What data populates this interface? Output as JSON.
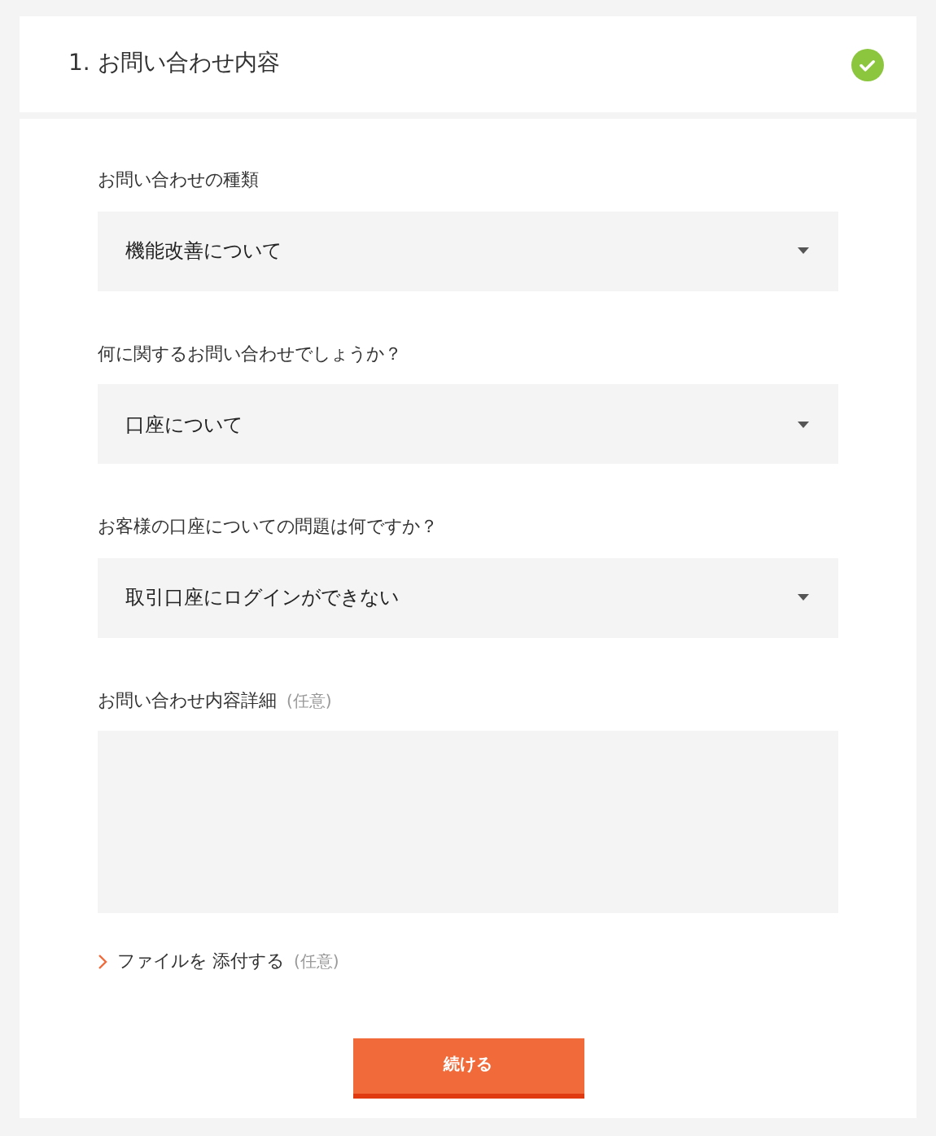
{
  "header": {
    "title": "1. お問い合わせ内容",
    "completed": true
  },
  "fields": [
    {
      "kind": "select",
      "label": "お問い合わせの種類",
      "value": "機能改善について"
    },
    {
      "kind": "select",
      "label": "何に関するお問い合わせでしょうか？",
      "value": "口座について"
    },
    {
      "kind": "select",
      "label": "お客様の口座についての問題は何ですか？",
      "value": "取引口座にログインができない"
    },
    {
      "kind": "textarea",
      "label": "お問い合わせ内容詳細",
      "optional": "(任意)"
    }
  ],
  "attachment": {
    "label": "ファイルを 添付する",
    "optional": "(任意)"
  },
  "button": "続ける"
}
